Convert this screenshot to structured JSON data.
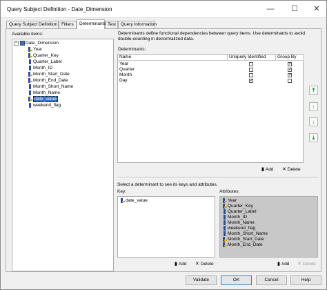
{
  "window": {
    "title": "Query Subject Definition - Date_Dimension",
    "controls": [
      "minimize",
      "maximize",
      "close"
    ]
  },
  "tabs": [
    {
      "label": "Query Subject Definition",
      "active": false
    },
    {
      "label": "Filters",
      "active": false
    },
    {
      "label": "Determinants",
      "active": true
    },
    {
      "label": "Test",
      "active": false
    },
    {
      "label": "Query Information",
      "active": false
    }
  ],
  "available_items": {
    "label": "Available items:",
    "root": "Date_Dimension",
    "items": [
      {
        "label": "Year",
        "icon": "key-attribute-icon"
      },
      {
        "label": "Quarter_Key",
        "icon": "key-attribute-icon"
      },
      {
        "label": "Quarter_Label",
        "icon": "attribute-icon"
      },
      {
        "label": "Month_ID",
        "icon": "attribute-icon"
      },
      {
        "label": "Month_Start_Date",
        "icon": "key-attribute-icon"
      },
      {
        "label": "Month_End_Date",
        "icon": "key-attribute-icon"
      },
      {
        "label": "Month_Short_Name",
        "icon": "attribute-icon"
      },
      {
        "label": "Month_Name",
        "icon": "attribute-icon"
      },
      {
        "label": "date_value",
        "icon": "key-attribute-icon",
        "selected": true
      },
      {
        "label": "weekend_flag",
        "icon": "attribute-icon"
      }
    ]
  },
  "determinants": {
    "description": "Determinants define functional dependencies between query items. Use determinants to avoid double-counting in denormalized data.",
    "label": "Determinants:",
    "columns": [
      "Name",
      "Uniquely Identified",
      "Group By"
    ],
    "rows": [
      {
        "name": "Year",
        "uniquely_identified": false,
        "group_by": true
      },
      {
        "name": "Quarter",
        "uniquely_identified": false,
        "group_by": true
      },
      {
        "name": "Month",
        "uniquely_identified": false,
        "group_by": true
      },
      {
        "name": "Day",
        "uniquely_identified": true,
        "group_by": false
      }
    ],
    "add_label": "Add",
    "delete_label": "Delete"
  },
  "lower": {
    "hint": "Select a determinant to see its keys and attributes.",
    "key_label": "Key:",
    "attributes_label": "Attributes:",
    "key_items": [
      "date_value"
    ],
    "attribute_items": [
      "Year",
      "Quarter_Key",
      "Quarter_Label",
      "Month_ID",
      "Month_Name",
      "weekend_flag",
      "Month_Short_Name",
      "Month_Start_Date",
      "Month_End_Date"
    ],
    "add_label": "Add",
    "delete_label": "Delete"
  },
  "footer": {
    "validate": "Validate",
    "ok": "OK",
    "cancel": "Cancel",
    "help": "Help"
  }
}
